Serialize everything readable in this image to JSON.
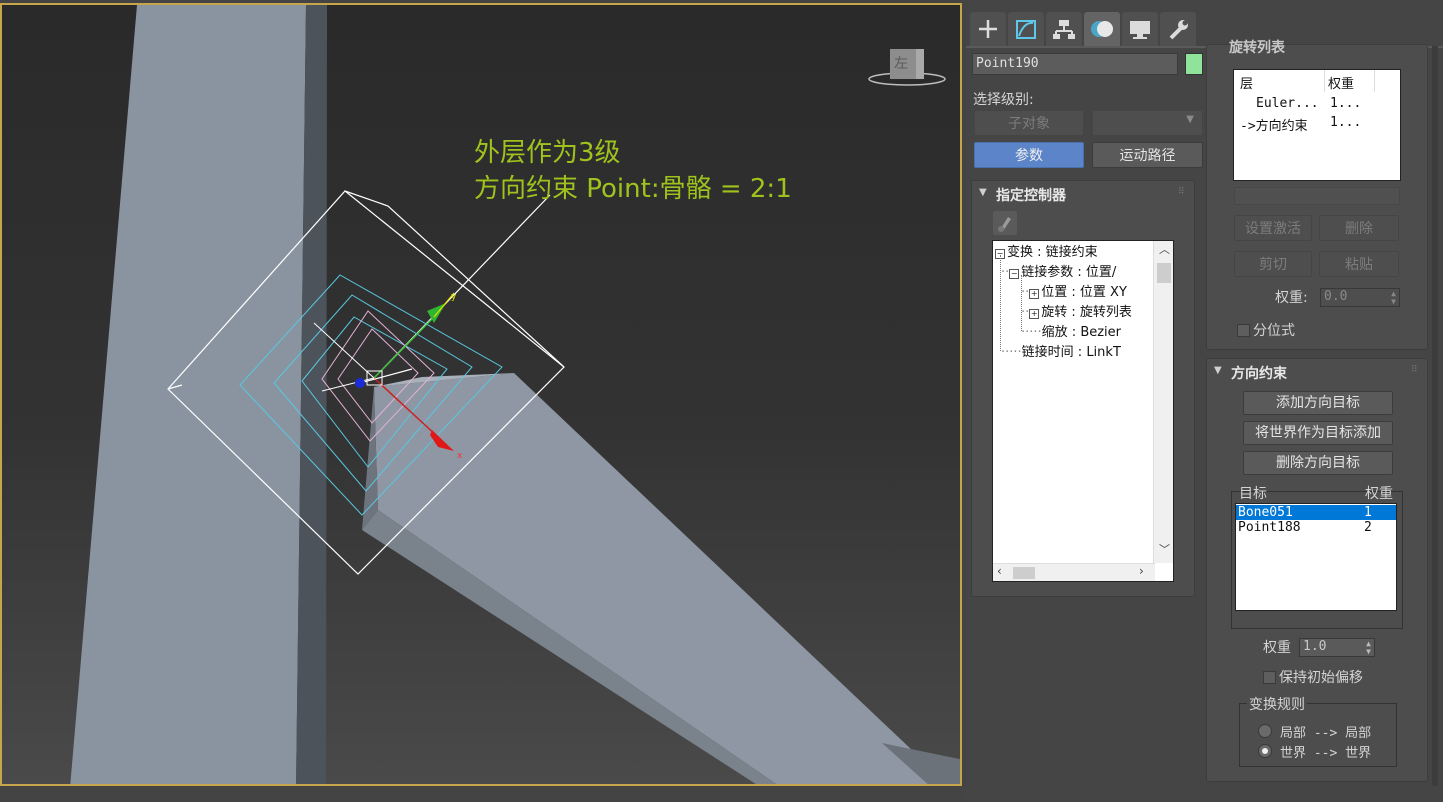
{
  "viewport": {
    "annotation_line1": "外层作为3级",
    "annotation_line2": "方向约束 Point:骨骼 = 2:1",
    "viewcube_label": "左"
  },
  "tabs": [
    {
      "icon": "create-plus-icon"
    },
    {
      "icon": "modify-icon"
    },
    {
      "icon": "hierarchy-icon"
    },
    {
      "icon": "motion-icon",
      "active": true
    },
    {
      "icon": "display-icon"
    },
    {
      "icon": "utilities-wrench-icon"
    }
  ],
  "object": {
    "name": "Point190",
    "color": "#90e39a"
  },
  "selection_level": {
    "label": "选择级别:",
    "sub_object": "子对象",
    "parameters": "参数",
    "motion_paths": "运动路径"
  },
  "assign_controller": {
    "title": "指定控制器",
    "tree": [
      {
        "text": "变换 : 链接约束"
      },
      {
        "text": "链接参数 : 位置/"
      },
      {
        "text": "位置 : 位置 XY"
      },
      {
        "text": "旋转 : 旋转列表"
      },
      {
        "text": "缩放 : Bezier"
      },
      {
        "text": "链接时间 : LinkT"
      }
    ]
  },
  "rotation_list": {
    "title": "旋转列表",
    "col_layer": "层",
    "col_weight": "权重",
    "rows": [
      {
        "layer": "Euler...",
        "weight": "1..."
      },
      {
        "layer": "->方向约束",
        "weight": "1..."
      }
    ],
    "set_active": "设置激活",
    "delete": "删除",
    "cut": "剪切",
    "paste": "粘贴",
    "weight_label": "权重:",
    "weight_value": "0.0",
    "average_label": "分位式"
  },
  "orientation_constraint": {
    "title": "方向约束",
    "add_target": "添加方向目标",
    "add_world": "将世界作为目标添加",
    "delete_target": "删除方向目标",
    "col_target": "目标",
    "col_weight": "权重",
    "targets": [
      {
        "name": "Bone051",
        "weight": "1",
        "selected": true
      },
      {
        "name": "Point188",
        "weight": "2",
        "selected": false
      }
    ],
    "weight_label": "权重",
    "weight_value": "1.0",
    "keep_offset": "保持初始偏移",
    "transform_rule": "变换规则",
    "rule_local": "局部 --> 局部",
    "rule_world": "世界 --> 世界"
  }
}
